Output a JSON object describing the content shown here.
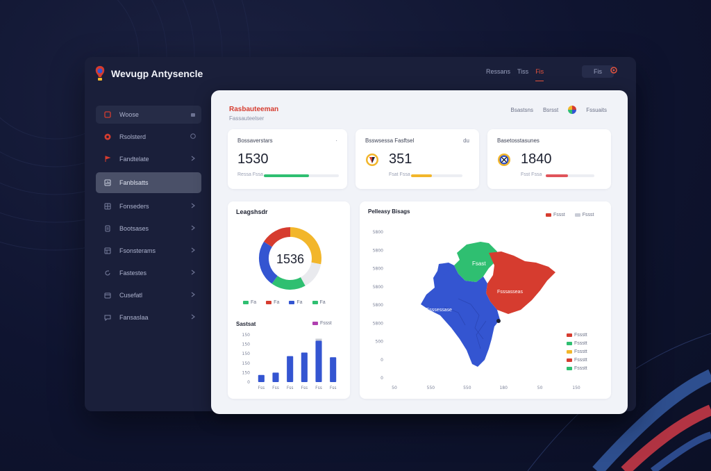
{
  "app": {
    "title": "Wevugp Antysencle"
  },
  "topbar": {
    "links": [
      "Ressans",
      "Tiss"
    ],
    "active_link": "Fis",
    "user": "Fis"
  },
  "sidebar": {
    "items": [
      {
        "label": "Woose",
        "icon": "window-icon"
      },
      {
        "label": "Rsolsterd",
        "icon": "shield-icon"
      },
      {
        "label": "Fandtelate",
        "icon": "flag-icon"
      },
      {
        "label": "Fanblsatts",
        "icon": "chart-icon"
      },
      {
        "label": "Fonseders",
        "icon": "grid-icon"
      },
      {
        "label": "Bootsases",
        "icon": "document-icon"
      },
      {
        "label": "Fsonsterams",
        "icon": "table-icon"
      },
      {
        "label": "Fastestes",
        "icon": "refresh-icon"
      },
      {
        "label": "Cusefatl",
        "icon": "calendar-icon"
      },
      {
        "label": "Fansaslaa",
        "icon": "message-icon"
      }
    ]
  },
  "main": {
    "title": "Rasbauteeman",
    "subtitle": "Fassauteelser",
    "actions": [
      "Bsastsns",
      "Bsrsst",
      "Fssuaits"
    ]
  },
  "kpis": [
    {
      "label": "Bossaverstars",
      "value": "1530",
      "sub": "Ressa Fssa",
      "progress": 0.6,
      "color": "#2fbf71",
      "extra": "·"
    },
    {
      "label": "Bsswsessa Fasftsel",
      "value": "351",
      "sub": "Fsat Fssa",
      "progress": 0.4,
      "color": "#f2b62b",
      "extra": "du"
    },
    {
      "label": "Basetosstasunes",
      "value": "1840",
      "sub": "Fsst Fssa",
      "progress": 0.45,
      "color": "#e0545a",
      "extra": ""
    }
  ],
  "donut": {
    "title": "Leagshsdr",
    "center": "1536",
    "segments": [
      {
        "value": 28,
        "color": "#f2b62b"
      },
      {
        "value": 14,
        "color": "#e9eaee"
      },
      {
        "value": 18,
        "color": "#2fbf71"
      },
      {
        "value": 24,
        "color": "#3455d1"
      },
      {
        "value": 16,
        "color": "#d63c2f"
      }
    ],
    "legend": [
      {
        "label": "Fa",
        "color": "#2fbf71"
      },
      {
        "label": "Fa",
        "color": "#d63c2f"
      },
      {
        "label": "Fa",
        "color": "#3455d1"
      },
      {
        "label": "Fa",
        "color": "#2fbf71"
      }
    ]
  },
  "bar_card": {
    "title": "Sastsat",
    "legend": "Fssst",
    "legend_color": "#b03fb0"
  },
  "map_card": {
    "title": "Pelleasy Bisags",
    "legend_top": [
      {
        "label": "Fssst",
        "color": "#d63c2f"
      },
      {
        "label": "Fssst",
        "color": "#c9ccd6"
      }
    ],
    "region_labels": {
      "north": "Fsast",
      "east": "Fsssasseas",
      "west": "Fsssessase"
    },
    "legend": [
      {
        "label": "Fssstt",
        "color": "#d63c2f"
      },
      {
        "label": "Fssstt",
        "color": "#2fbf71"
      },
      {
        "label": "Fssstt",
        "color": "#f2b62b"
      },
      {
        "label": "Fssstt",
        "color": "#d63c2f"
      },
      {
        "label": "Fssstt",
        "color": "#2fbf71"
      }
    ]
  },
  "chart_data": [
    {
      "type": "bar",
      "categories": [
        "Fss",
        "Fss",
        "Fss",
        "Fss",
        "Fss",
        "Fss"
      ],
      "values": [
        30,
        40,
        110,
        125,
        175,
        105
      ],
      "ylim": [
        0,
        200
      ],
      "yticks": [
        "0",
        "150",
        "150",
        "150",
        "150",
        "150"
      ]
    },
    {
      "type": "map",
      "yticks": [
        "5800",
        "5800",
        "5800",
        "5800",
        "5800",
        "5800",
        "500",
        "0",
        "0"
      ],
      "xticks": [
        "50",
        "550",
        "550",
        "180",
        "50",
        "150"
      ]
    }
  ]
}
